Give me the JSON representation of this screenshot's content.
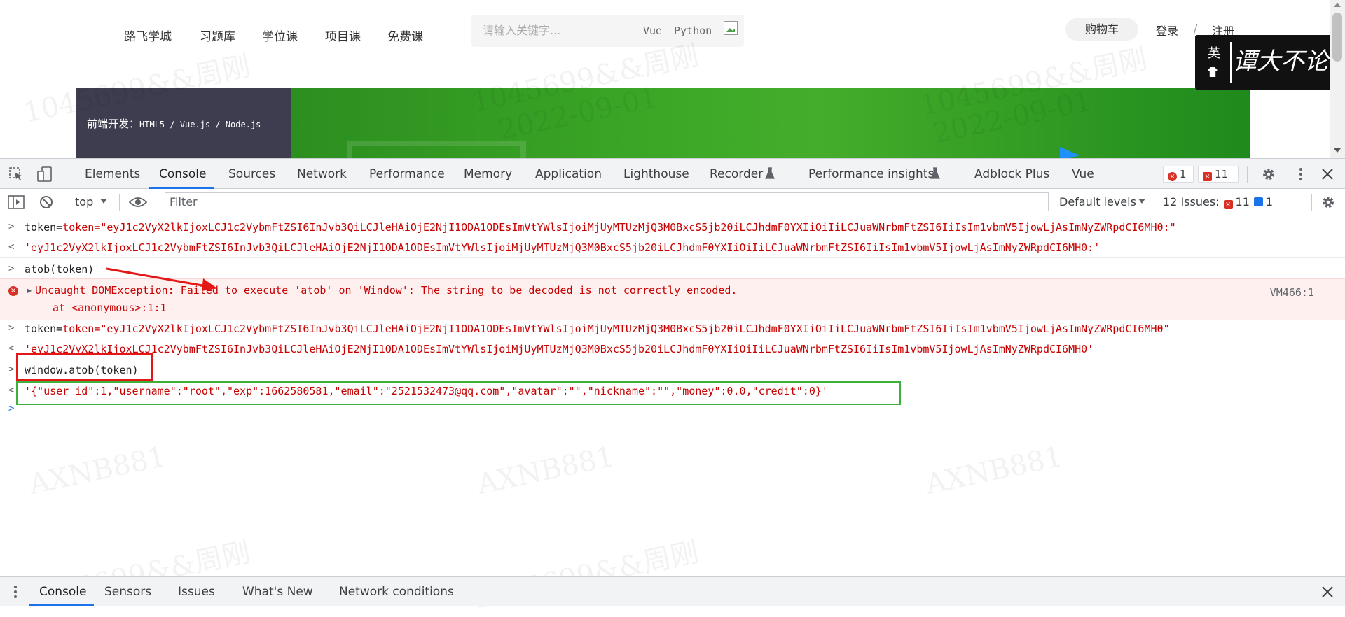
{
  "site": {
    "nav": [
      "路飞学城",
      "习题库",
      "学位课",
      "项目课",
      "免费课"
    ],
    "search_placeholder": "请输入关键字...",
    "search_tags": [
      "Vue",
      "Python"
    ],
    "cart": "购物车",
    "login": "登录",
    "separator": "/",
    "register": "注册",
    "banner_text": "前端开发：",
    "banner_tech": "HTML5 / Vue.js / Node.js",
    "badge_char": "英",
    "badge_signature": "谭大不论."
  },
  "devtools": {
    "tabs": [
      "Elements",
      "Console",
      "Sources",
      "Network",
      "Performance",
      "Memory",
      "Application",
      "Lighthouse",
      "Recorder",
      "Performance insights",
      "Adblock Plus",
      "Vue"
    ],
    "error_count": "1",
    "issue_count": "11",
    "toolbar": {
      "context": "top",
      "filter_placeholder": "Filter",
      "levels": "Default levels",
      "issues_label": "12 Issues:",
      "issues_red": "11",
      "issues_blue": "1"
    },
    "console": {
      "l1_in": "token=\"eyJ1c2VyX2lkIjoxLCJ1c2VybmFtZSI6InJvb3QiLCJleHAiOjE2NjI1ODA1ODEsImVtYWlsIjoiMjUyMTUzMjQ3M0BxcS5jb20iLCJhdmF0YXIiOiIiLCJuaWNrbmFtZSI6IiIsIm1vbmV5IjowLjAsImNyZWRpdCI6MH0:\"",
      "l1_out": "'eyJ1c2VyX2lkIjoxLCJ1c2VybmFtZSI6InJvb3QiLCJleHAiOjE2NjI1ODA1ODEsImVtYWlsIjoiMjUyMTUzMjQ3M0BxcS5jb20iLCJhdmF0YXIiOiIiLCJuaWNrbmFtZSI6IiIsIm1vbmV5IjowLjAsImNyZWRpdCI6MH0:'",
      "l2_in": "atob(token)",
      "error_msg": "Uncaught DOMException: Failed to execute 'atob' on 'Window': The string to be decoded is not correctly encoded.",
      "error_at": "at <anonymous>:1:1",
      "error_link": "VM466:1",
      "l3_in": "token=\"eyJ1c2VyX2lkIjoxLCJ1c2VybmFtZSI6InJvb3QiLCJleHAiOjE2NjI1ODA1ODEsImVtYWlsIjoiMjUyMTUzMjQ3M0BxcS5jb20iLCJhdmF0YXIiOiIiLCJuaWNrbmFtZSI6IiIsIm1vbmV5IjowLjAsImNyZWRpdCI6MH0\"",
      "l3_out": "'eyJ1c2VyX2lkIjoxLCJ1c2VybmFtZSI6InJvb3QiLCJleHAiOjE2NjI1ODA1ODEsImVtYWlsIjoiMjUyMTUzMjQ3M0BxcS5jb20iLCJhdmF0YXIiOiIiLCJuaWNrbmFtZSI6IiIsIm1vbmV5IjowLjAsImNyZWRpdCI6MH0'",
      "l4_in": "window.atob(token)",
      "l4_out": "'{\"user_id\":1,\"username\":\"root\",\"exp\":1662580581,\"email\":\"2521532473@qq.com\",\"avatar\":\"\",\"nickname\":\"\",\"money\":0.0,\"credit\":0}'"
    },
    "drawer_tabs": [
      "Console",
      "Sensors",
      "Issues",
      "What's New",
      "Network conditions"
    ]
  },
  "watermarks": [
    "1045699&&周刚",
    "2022-09-01",
    "AXNB881"
  ]
}
